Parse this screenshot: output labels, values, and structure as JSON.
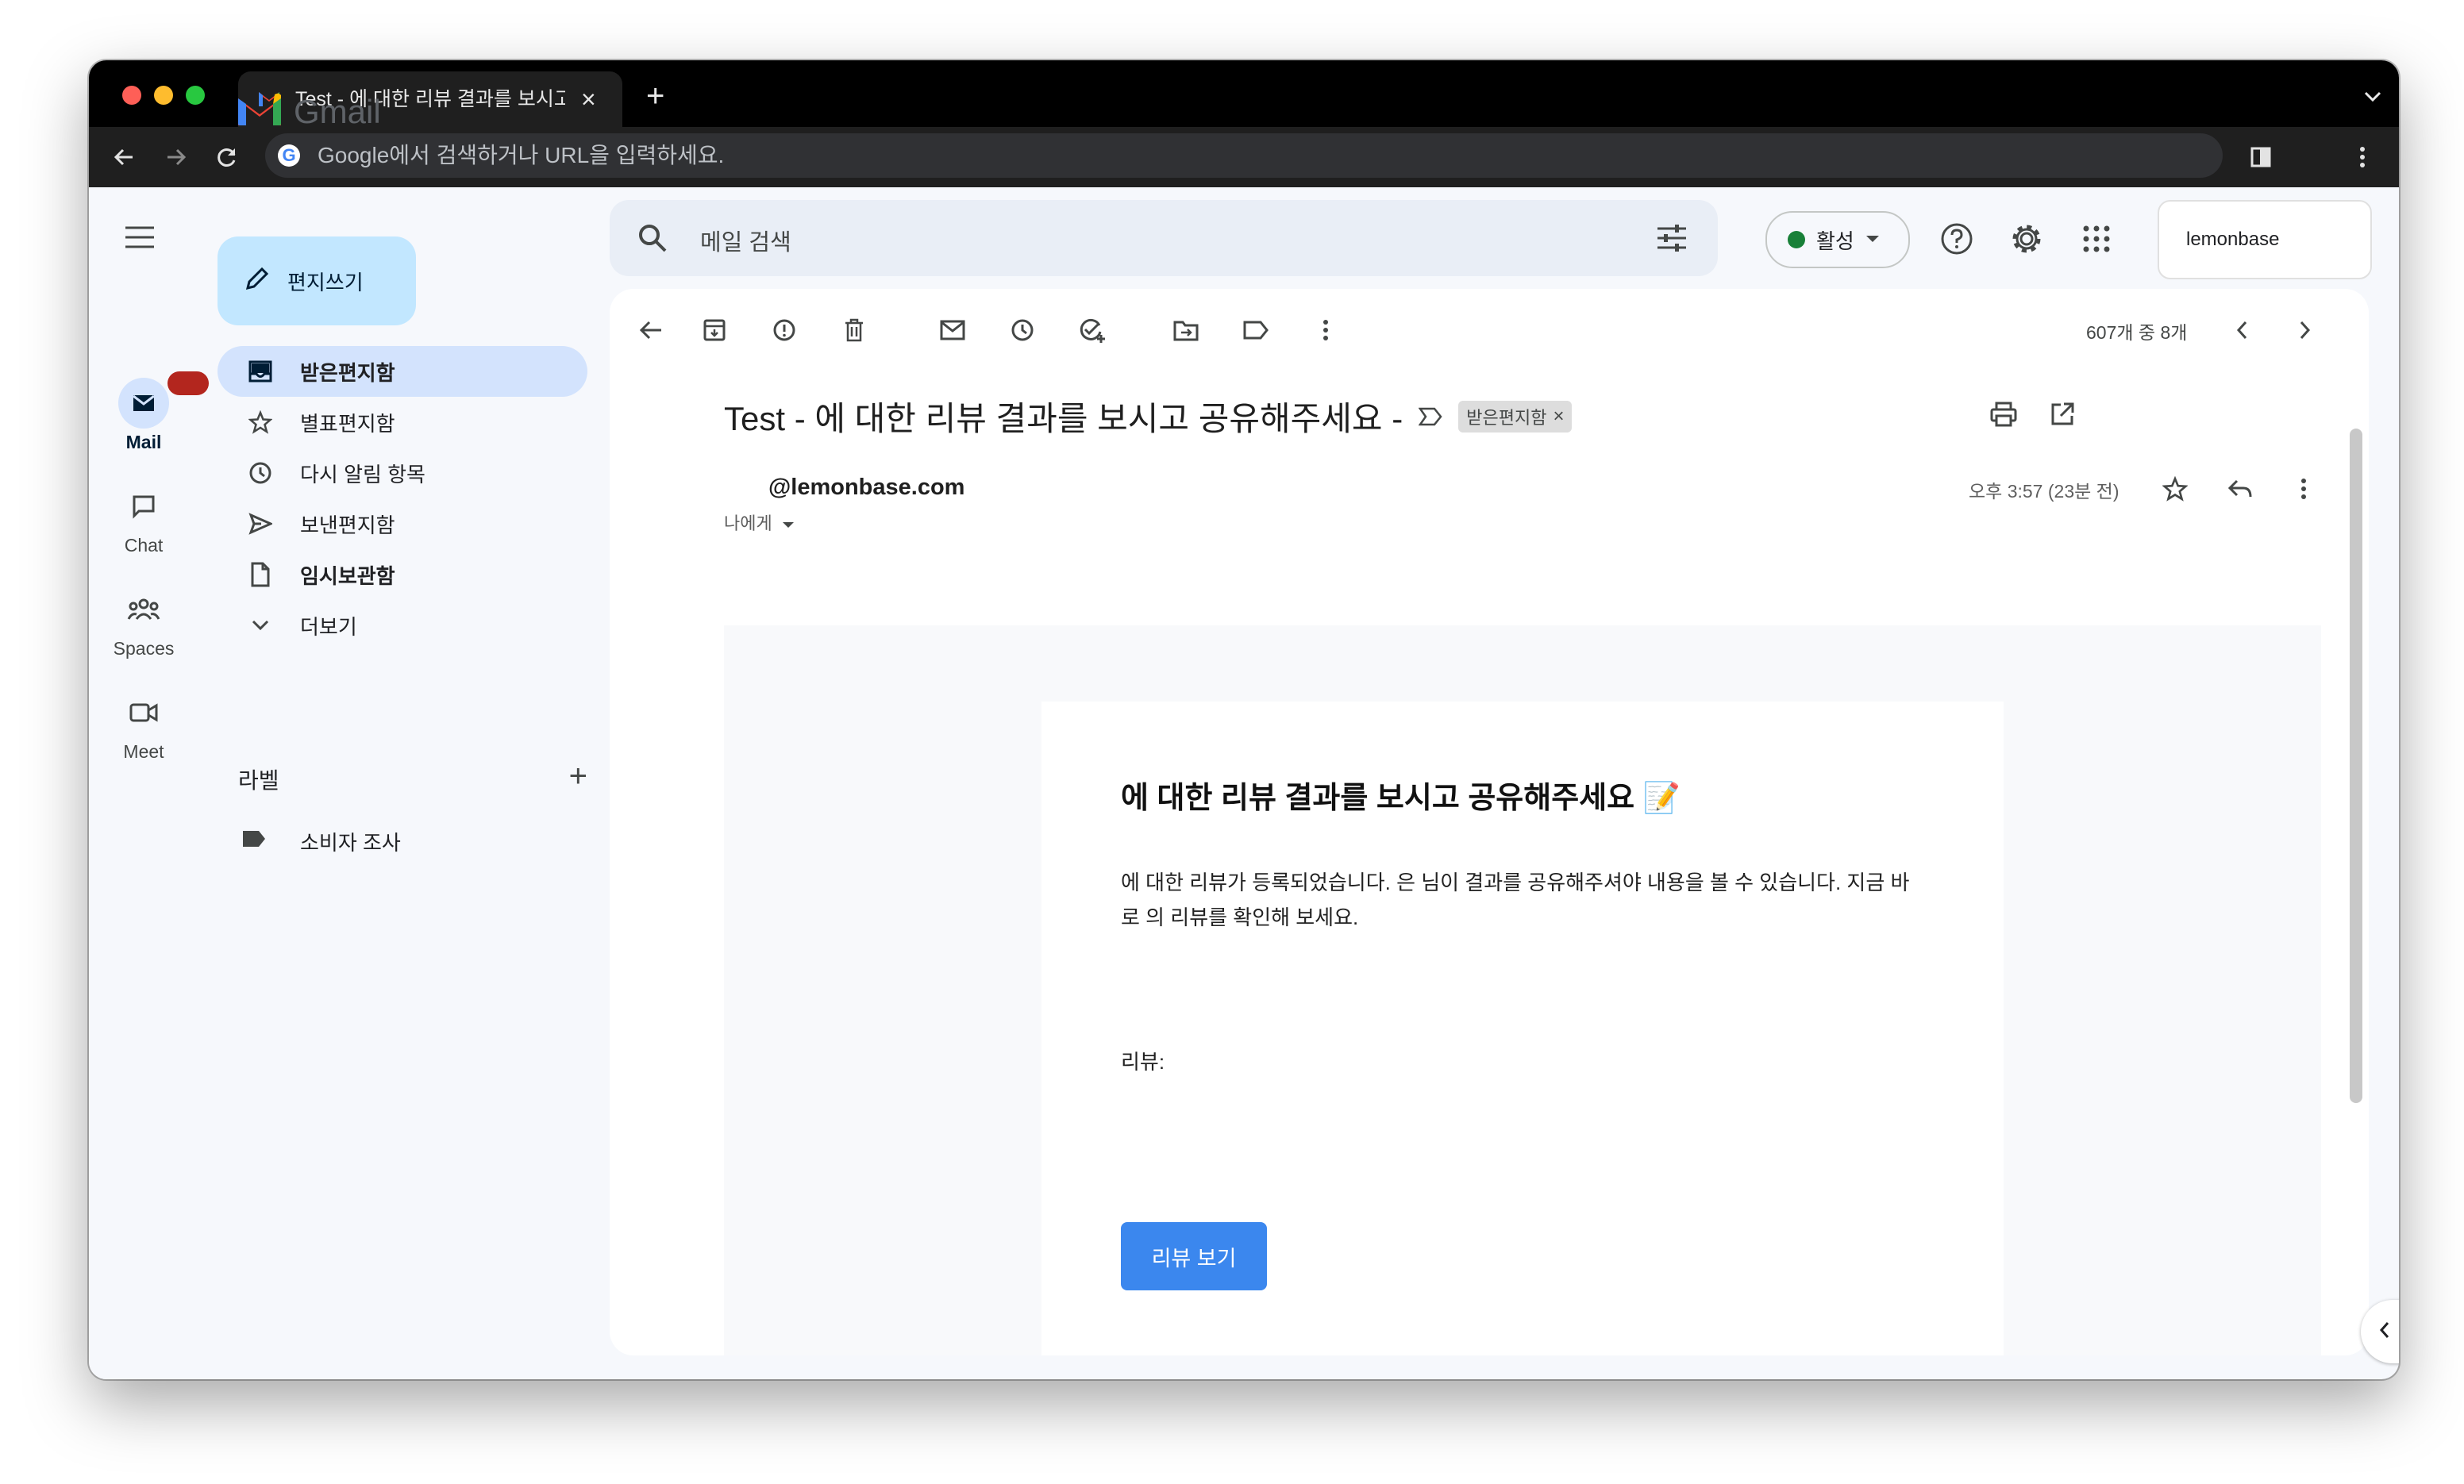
{
  "browser": {
    "tab_title": "Test - 에 대한 리뷰 결과를 보시고 공유해주세요",
    "address_placeholder": "Google에서 검색하거나 URL을 입력하세요."
  },
  "rail": {
    "items": [
      {
        "label": "Mail"
      },
      {
        "label": "Chat"
      },
      {
        "label": "Spaces"
      },
      {
        "label": "Meet"
      }
    ]
  },
  "app": {
    "name": "Gmail"
  },
  "compose": {
    "label": "편지쓰기"
  },
  "nav": {
    "items": [
      {
        "label": "받은편지함"
      },
      {
        "label": "별표편지함"
      },
      {
        "label": "다시 알림 항목"
      },
      {
        "label": "보낸편지함"
      },
      {
        "label": "임시보관함"
      },
      {
        "label": "더보기"
      }
    ]
  },
  "labels": {
    "heading": "라벨",
    "items": [
      {
        "label": "소비자 조사"
      }
    ]
  },
  "search": {
    "placeholder": "메일 검색"
  },
  "status": {
    "label": "활성",
    "color": "#188038"
  },
  "account": {
    "name": "lemonbase"
  },
  "message": {
    "pager": "607개 중 8개",
    "subject": "Test - 에 대한 리뷰 결과를 보시고 공유해주세요 -",
    "folder_chip": "받은편지함",
    "sender": "@lemonbase.com",
    "recipient": "나에게",
    "time": "오후 3:57 (23분 전)"
  },
  "email": {
    "heading": "에 대한 리뷰 결과를 보시고 공유해주세요 📝",
    "body": "에 대한 리뷰가 등록되었습니다. 은 님이 결과를 공유해주셔야 내용을 볼 수 있습니다. 지금 바로 의 리뷰를 확인해 보세요.",
    "review_label": "리뷰:",
    "button_label": "리뷰 보기",
    "button_color": "#3b87ee"
  }
}
